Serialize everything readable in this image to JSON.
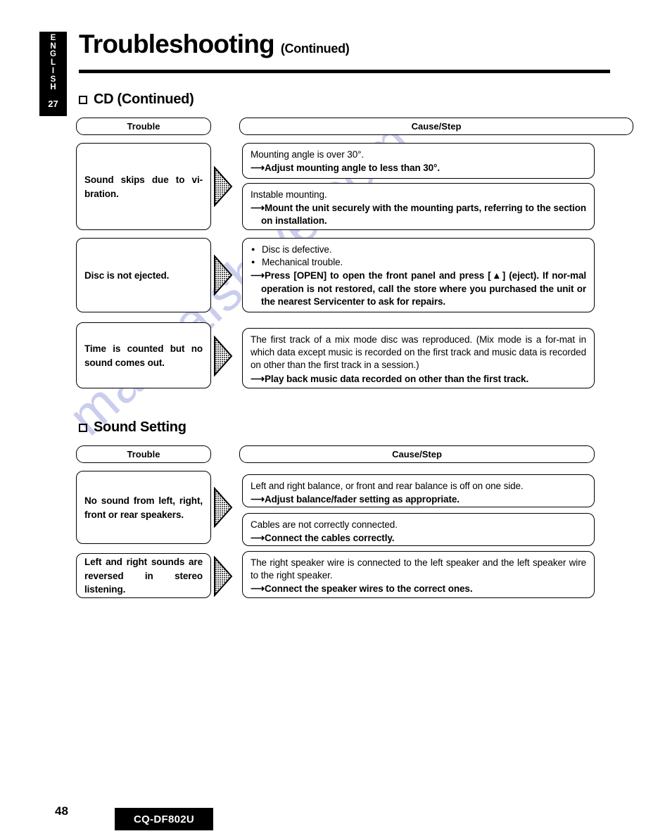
{
  "side_tab": {
    "language_letters": [
      "E",
      "N",
      "G",
      "L",
      "I",
      "S",
      "H"
    ],
    "chapter_number": "27"
  },
  "header": {
    "title": "Troubleshooting",
    "subtitle": "(Continued)"
  },
  "footer": {
    "page_number": "48",
    "model": "CQ-DF802U"
  },
  "watermark": {
    "text": "manualshive.com",
    "color": "#b9bde8"
  },
  "columns": {
    "trouble_label": "Trouble",
    "cause_label": "Cause/Step"
  },
  "sections": [
    {
      "heading": "CD (Continued)",
      "rows": [
        {
          "trouble": "Sound skips due to vi-bration.",
          "causes": [
            {
              "lines": [
                {
                  "style": "normal",
                  "text": "Mounting angle is over 30°."
                },
                {
                  "style": "arrow",
                  "text": "Adjust mounting angle to less than 30°."
                }
              ]
            },
            {
              "lines": [
                {
                  "style": "normal",
                  "text": "Instable mounting."
                },
                {
                  "style": "arrow",
                  "text": "Mount the unit securely with the mounting parts, referring to the section on installation."
                }
              ]
            }
          ]
        },
        {
          "trouble": "Disc is not ejected.",
          "causes": [
            {
              "lines": [
                {
                  "style": "bullet",
                  "text": "Disc is defective."
                },
                {
                  "style": "bullet",
                  "text": "Mechanical trouble."
                },
                {
                  "style": "arrow",
                  "text": "Press [OPEN] to open the front panel and press [▲] (eject). If nor-mal operation is not restored, call the store where you purchased the unit or the nearest Servicenter to ask for repairs."
                }
              ]
            }
          ]
        },
        {
          "trouble": "Time is counted but no sound comes out.",
          "causes": [
            {
              "lines": [
                {
                  "style": "normal",
                  "text": "The first track of a mix mode disc was reproduced. (Mix mode is a for-mat in which data except music is recorded on the first track and music data is recorded on other than the first track in a session.)"
                },
                {
                  "style": "arrow",
                  "text": "Play back music data recorded on other than the first track."
                }
              ]
            }
          ]
        }
      ]
    },
    {
      "heading": "Sound Setting",
      "rows": [
        {
          "trouble": "No sound from left, right, front or rear speakers.",
          "causes": [
            {
              "lines": [
                {
                  "style": "normal",
                  "text": "Left and right balance, or front and rear balance is off on one side."
                },
                {
                  "style": "arrow",
                  "text": "Adjust balance/fader setting as appropriate."
                }
              ]
            },
            {
              "lines": [
                {
                  "style": "normal",
                  "text": "Cables are not correctly connected."
                },
                {
                  "style": "arrow",
                  "text": "Connect the cables correctly."
                }
              ]
            }
          ]
        },
        {
          "trouble": "Left and right sounds are reversed in stereo listening.",
          "causes": [
            {
              "lines": [
                {
                  "style": "normal",
                  "text": "The right speaker wire is connected to the left speaker and the left speaker wire to the right speaker."
                },
                {
                  "style": "arrow",
                  "text": "Connect the speaker wires to the correct ones."
                }
              ]
            }
          ]
        }
      ]
    }
  ]
}
